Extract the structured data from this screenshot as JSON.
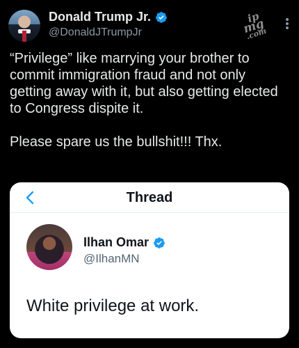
{
  "author": {
    "display_name": "Donald Trump Jr.",
    "handle": "@DonaldJTrumpJr",
    "verified": true
  },
  "watermark": {
    "line1": "ip",
    "line2": "mg",
    "line3": ".com"
  },
  "tweet": {
    "paragraph1": "“Privilege” like marrying your brother to commit immigration fraud and not only getting away with it, but also getting elected to Congress dispite it.",
    "paragraph2": "Please spare us the bullshit!!! Thx."
  },
  "quoted": {
    "header_title": "Thread",
    "display_name": "Ilhan Omar",
    "handle": "@IlhanMN",
    "verified": true,
    "text": "White privilege at work."
  },
  "icons": {
    "verified": "verified-badge-icon",
    "back": "chevron-left-icon",
    "more": "more-vertical-icon"
  },
  "colors": {
    "verified_blue": "#1d9bf0",
    "back_blue": "#1d9bf0",
    "secondary_text_dark": "#8b98a5",
    "secondary_text_light": "#536471"
  }
}
